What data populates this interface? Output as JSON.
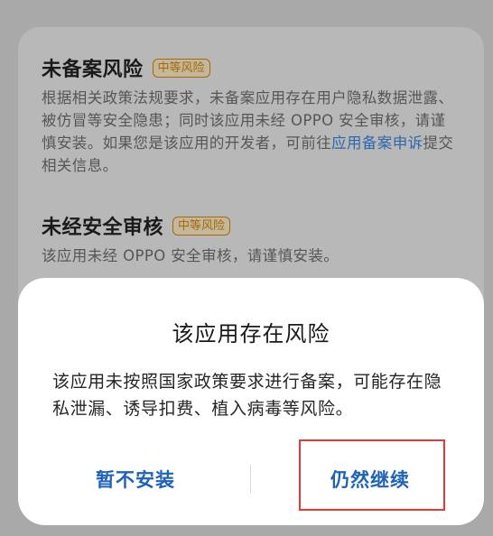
{
  "risk_list": {
    "items": [
      {
        "title": "未备案风险",
        "badge": "中等风险",
        "desc_prefix": "根据相关政策法规要求，未备案应用存在用户隐私数据泄露、被仿冒等安全隐患；同时该应用未经 OPPO 安全审核，请谨慎安装。如果您是该应用的开发者，可前往",
        "link": "应用备案申诉",
        "desc_suffix": "提交相关信息。"
      },
      {
        "title": "未经安全审核",
        "badge": "中等风险",
        "desc_prefix": "该应用未经 OPPO 安全审核，请谨慎安装。",
        "link": "",
        "desc_suffix": ""
      }
    ]
  },
  "dialog": {
    "title": "该应用存在风险",
    "message": "该应用未按照国家政策要求进行备案，可能存在隐私泄漏、诱导扣费、植入病毒等风险。",
    "cancel_label": "暂不安装",
    "continue_label": "仍然继续"
  },
  "colors": {
    "accent": "#1f63b9",
    "badge": "#a36a0c",
    "highlight": "#e53935"
  }
}
